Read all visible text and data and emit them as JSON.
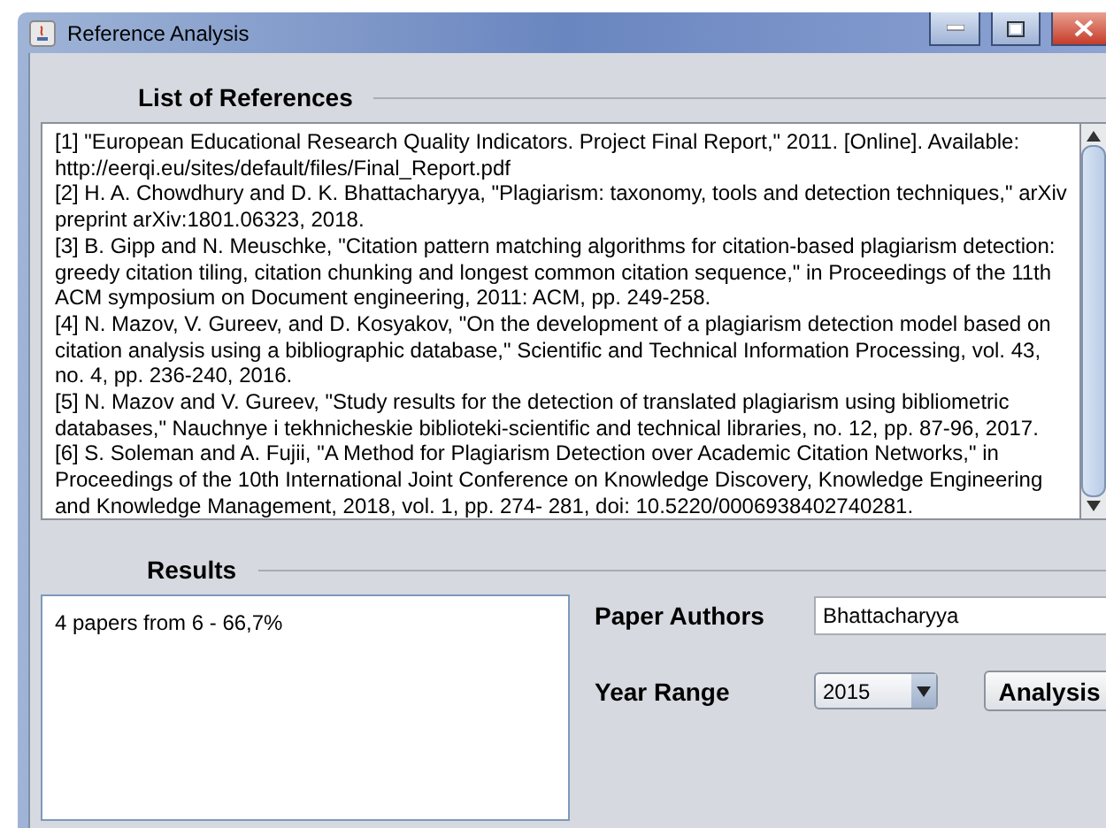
{
  "window": {
    "title": "Reference Analysis"
  },
  "references": {
    "heading": "List of References",
    "items": [
      "[1] \"European Educational Research Quality Indicators. Project Final Report,\" 2011. [Online]. Available: http://eerqi.eu/sites/default/files/Final_Report.pdf",
      "[2] H. A. Chowdhury and D. K. Bhattacharyya, \"Plagiarism: taxonomy, tools and detection techniques,\" arXiv preprint arXiv:1801.06323, 2018.",
      "[3] B. Gipp and N. Meuschke, \"Citation pattern matching algorithms for citation-based plagiarism detection: greedy citation tiling, citation chunking and longest common citation sequence,\" in Proceedings of the 11th ACM symposium on Document engineering, 2011: ACM, pp. 249-258.",
      "[4] N. Mazov, V. Gureev, and D. Kosyakov, \"On the development of a plagiarism detection model based on citation analysis using a bibliographic database,\" Scientific and Technical Information Processing, vol. 43, no. 4, pp. 236-240, 2016.",
      "[5] N. Mazov and V. Gureev, \"Study results for the detection of translated plagiarism using bibliometric databases,\" Nauchnye i tekhnicheskie biblioteki-scientific and technical libraries, no. 12, pp. 87-96, 2017.",
      "[6] S. Soleman and A. Fujii, \"A Method for Plagiarism Detection over Academic Citation Networks,\" in Proceedings of the 10th International Joint Conference on Knowledge Discovery, Knowledge Engineering and Knowledge Management, 2018, vol. 1, pp. 274-  281, doi: 10.5220/0006938402740281."
    ]
  },
  "results": {
    "heading": "Results",
    "text": "4 papers from 6 - 66,7%"
  },
  "form": {
    "authors_label": "Paper Authors",
    "authors_value": "Bhattacharyya",
    "year_label": "Year Range",
    "year_value": "2015",
    "button": "Analysis"
  }
}
